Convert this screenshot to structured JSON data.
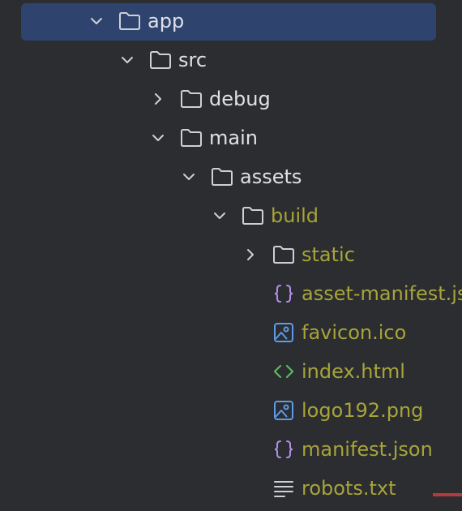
{
  "tree": {
    "items": [
      {
        "label": "app",
        "icon": "folder-icon",
        "chevron": "expanded",
        "selected": true
      },
      {
        "label": "src",
        "icon": "folder-icon",
        "chevron": "expanded"
      },
      {
        "label": "debug",
        "icon": "folder-icon",
        "chevron": "collapsed"
      },
      {
        "label": "main",
        "icon": "folder-icon",
        "chevron": "expanded"
      },
      {
        "label": "assets",
        "icon": "folder-icon",
        "chevron": "expanded"
      },
      {
        "label": "build",
        "icon": "folder-icon",
        "chevron": "expanded",
        "excluded": true
      },
      {
        "label": "static",
        "icon": "folder-icon",
        "chevron": "collapsed",
        "excluded": true
      },
      {
        "label": "asset-manifest.json",
        "icon": "json-braces-icon",
        "excluded": true
      },
      {
        "label": "favicon.ico",
        "icon": "image-file-icon",
        "excluded": true
      },
      {
        "label": "index.html",
        "icon": "html-tag-icon",
        "excluded": true
      },
      {
        "label": "logo192.png",
        "icon": "image-file-icon",
        "excluded": true
      },
      {
        "label": "manifest.json",
        "icon": "json-braces-icon",
        "excluded": true
      },
      {
        "label": "robots.txt",
        "icon": "text-file-icon",
        "excluded": true
      }
    ]
  },
  "colors": {
    "background": "#2b2d30",
    "selection": "#2e436e",
    "text": "#dfe1e5",
    "excluded_text": "#a8a43a",
    "json_icon": "#b58ee8",
    "image_icon": "#5e9be8",
    "html_icon": "#5fb85f",
    "folder_icon": "#ced0d6"
  }
}
